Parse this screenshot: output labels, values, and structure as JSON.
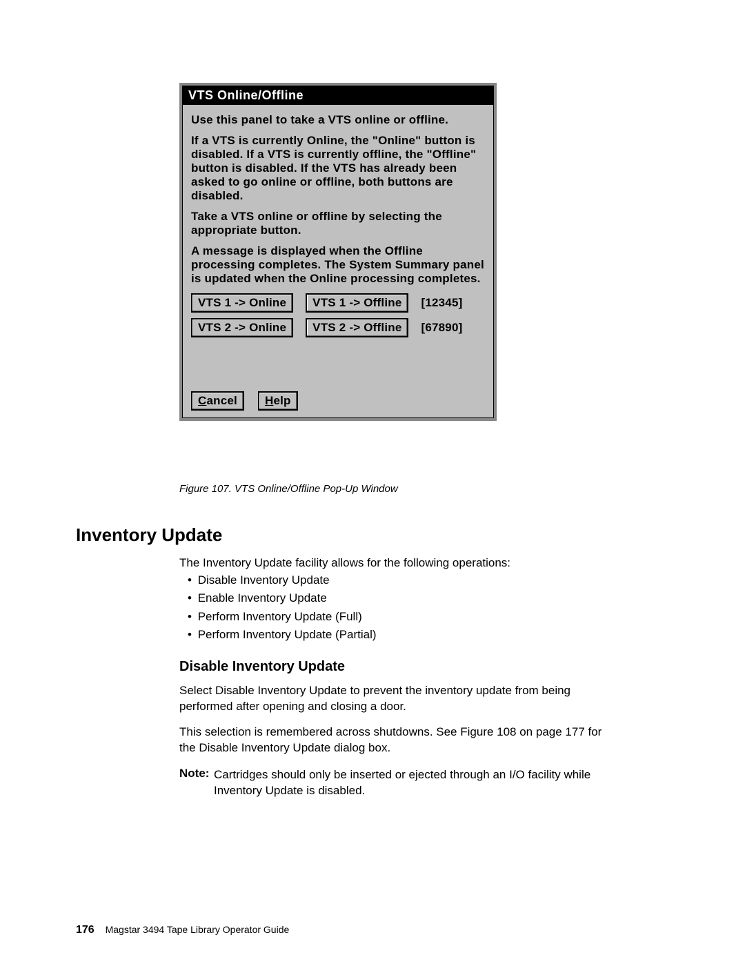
{
  "dialog": {
    "title": "VTS Online/Offline",
    "paragraphs": [
      "Use this panel to take a VTS online or offline.",
      "If a VTS is currently Online, the \"Online\" button is disabled. If a VTS is currently offline, the \"Offline\" button is disabled. If the VTS has already been asked to go online or offline, both buttons are disabled.",
      "Take a VTS online or offline by selecting the appropriate button.",
      "A message is displayed when the Offline processing completes. The System Summary panel is updated when the Online processing completes."
    ],
    "rows": [
      {
        "online": "VTS 1 -> Online",
        "offline": "VTS 1 -> Offline",
        "code": "[12345]"
      },
      {
        "online": "VTS 2 -> Online",
        "offline": "VTS 2 -> Offline",
        "code": "[67890]"
      }
    ],
    "cancel": "Cancel",
    "help": "Help"
  },
  "figure_caption": "Figure 107. VTS Online/Offline Pop-Up Window",
  "section_heading": "Inventory Update",
  "intro": "The Inventory Update facility allows for the following operations:",
  "bullets": [
    "Disable Inventory Update",
    "Enable Inventory Update",
    "Perform Inventory Update (Full)",
    "Perform Inventory Update (Partial)"
  ],
  "subheading": "Disable Inventory Update",
  "para1": "Select Disable Inventory Update to prevent the inventory update from being performed after opening and closing a door.",
  "para2": "This selection is remembered across shutdowns. See Figure 108 on page 177 for the Disable Inventory Update dialog box.",
  "note_label": "Note:",
  "note_text": "Cartridges should only be inserted or ejected through an I/O facility while Inventory Update is disabled.",
  "footer": {
    "page": "176",
    "title": "Magstar 3494 Tape Library Operator Guide"
  }
}
